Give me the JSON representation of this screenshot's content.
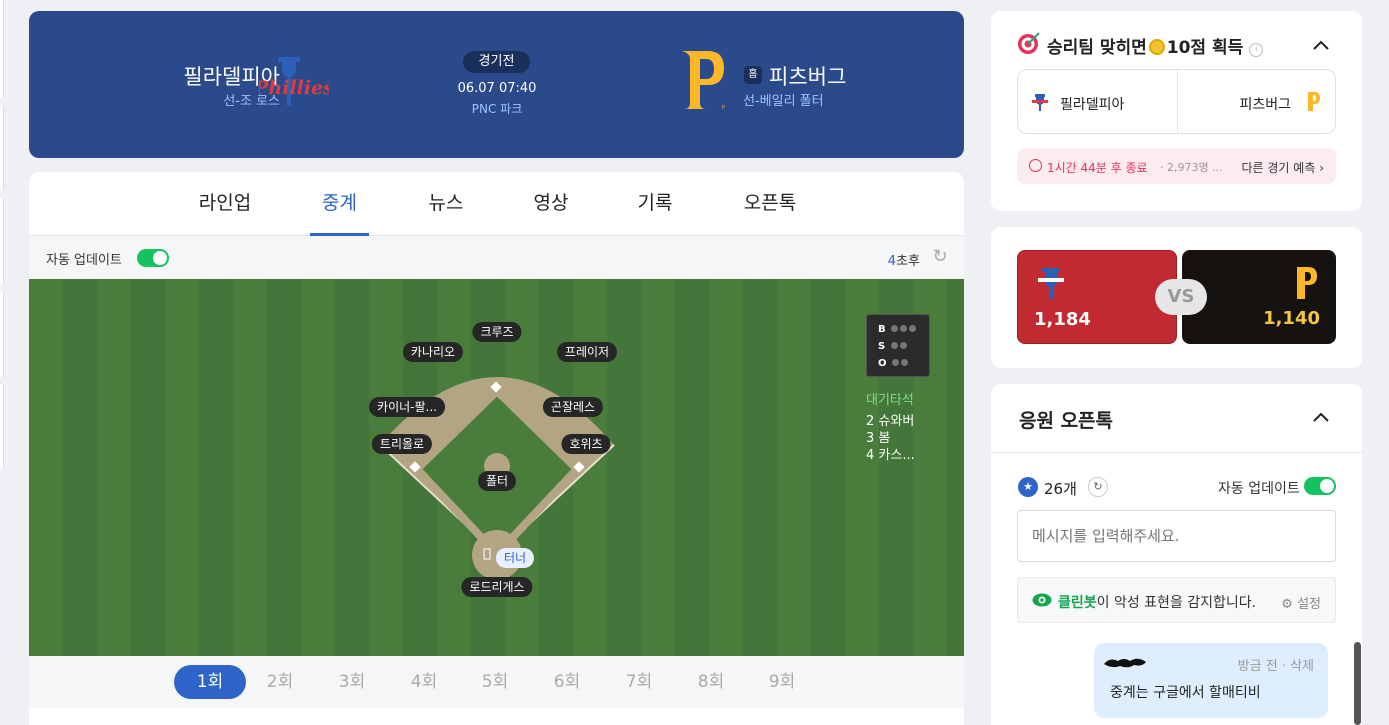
{
  "match": {
    "away": {
      "name": "필라델피아",
      "pitcher": "선-조 로스",
      "logo_text": "Phillies"
    },
    "home": {
      "badge": "홈",
      "name": "피츠버그",
      "pitcher": "선-베일리 폴터",
      "logo_text": "P"
    },
    "status": "경기전",
    "datetime": "06.07 07:40",
    "stadium": "PNC 파크"
  },
  "tabs": [
    "라인업",
    "중계",
    "뉴스",
    "영상",
    "기록",
    "오픈톡"
  ],
  "active_tab": "중계",
  "auto_update": {
    "label": "자동 업데이트",
    "on": true
  },
  "countdown": {
    "num": "4",
    "unit": "초후"
  },
  "field": {
    "players": {
      "lf": "카나리오",
      "cf": "크루즈",
      "rf": "프레이저",
      "ss": "카이너-팔...",
      "second_base": "곤잘레스",
      "third_base": "트리올로",
      "first_base": "호위츠",
      "pitcher": "폴터",
      "batter": "터너",
      "catcher": "로드리게스"
    },
    "bso": {
      "b": "B",
      "s": "S",
      "o": "O"
    },
    "ondeck": {
      "title": "대기타석",
      "items": [
        "2 슈와버",
        "3 봄",
        "4 카스..."
      ]
    }
  },
  "innings": [
    "1회",
    "2회",
    "3회",
    "4회",
    "5회",
    "6회",
    "7회",
    "8회",
    "9회"
  ],
  "active_inning": "1회",
  "predict": {
    "title_pre": "승리팀 맞히면",
    "title_post": "10점 획득",
    "info": "i",
    "away": "필라델피아",
    "home": "피츠버그",
    "deadline": "1시간 44분 후 종료",
    "participants": "· 2,973명 ...",
    "other": "다른 경기 예측"
  },
  "votes": {
    "away": "1,184",
    "home": "1,140",
    "vs": "VS"
  },
  "chat": {
    "title": "응원 오픈톡",
    "count": "26개",
    "auto_update": "자동 업데이트",
    "placeholder": "메시지를 입력해주세요.",
    "cleanbot_name": "클린봇",
    "cleanbot_text": "이 악성 표현을 감지합니다.",
    "settings": "설정",
    "message": {
      "meta": "방금 전 · 삭제",
      "text": "중계는 구글에서 할매티비"
    }
  },
  "colors": {
    "accent": "#2f64c8",
    "header_bg": "#2b4a8b",
    "field": "#4a7d3c",
    "phillies_red": "#c12a31",
    "pirates_gold": "#f5c543",
    "toggle_green": "#16c25f"
  }
}
